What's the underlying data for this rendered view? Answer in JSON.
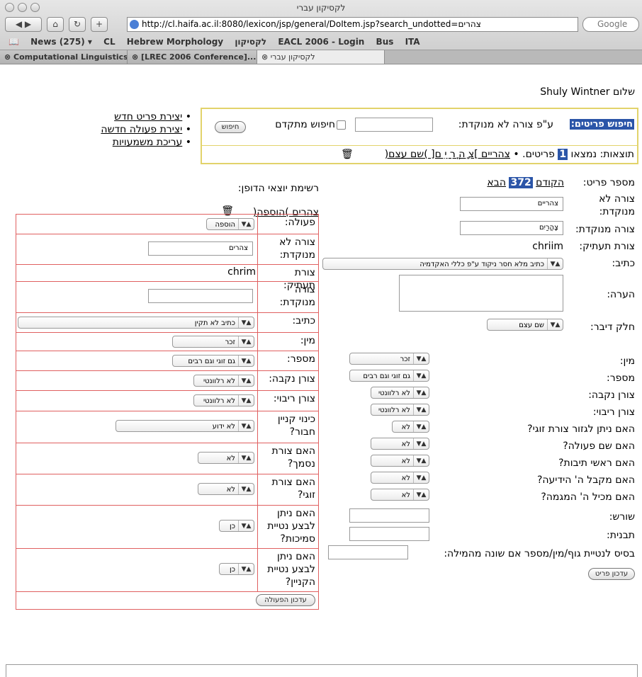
{
  "window": {
    "title": "לקסיקון עברי"
  },
  "toolbar": {
    "url": "http://cl.haifa.ac.il:8080/lexicon/jsp/general/DoItem.jsp?search_undotted=צהרים",
    "search_placeholder": "Google"
  },
  "bookmarks": [
    "News (275) ▾",
    "CL",
    "Hebrew Morphology",
    "לקסיקון",
    "EACL 2006 - Login",
    "Bus",
    "ITA"
  ],
  "tabs": [
    "Computational Linguistics",
    "[LREC 2006 Conference]...",
    "לקסיקון עברי"
  ],
  "greeting": "שלום Shuly Wintner",
  "links": [
    "יצירת פריט חדש",
    "יצירת פעולה חדשה",
    "עריכת משמעויות"
  ],
  "search": {
    "title": "חיפוש פריטים:",
    "by_undotted": "ע\"פ צורה לא מנוקדת:",
    "advanced": "חיפוש מתקדם",
    "button": "חיפוש"
  },
  "results": {
    "prefix": "תוצאות: נמצאו",
    "count": "1",
    "suffix": "פריטים.",
    "item": "צהריים ]צ ָה ֳר ַי ִם[ )שם עצם("
  },
  "item": {
    "number_label": "מספר פריט:",
    "prev": "הקודם",
    "number": "372",
    "next": "הבא",
    "undotted_label": "צורה לא מנוקדת:",
    "undotted_value": "צהריים",
    "dotted_label": "צורה מנוקדת:",
    "dotted_value": "צָהֳרַיִם",
    "translit_label": "צורת תעתיק:",
    "translit_value": "chriim",
    "spelling_label": "כתיב:",
    "spelling_value": "כתיב מלא חסר ניקוד ע\"פ כללי האקדמיה",
    "note_label": "הערה:",
    "pos_label": "חלק דיבר:",
    "pos_value": "שם עצם",
    "gender_label": "מין:",
    "gender_value": "זכר",
    "number2_label": "מספר:",
    "number2_value": "גם זוגי וגם רבים",
    "fem_label": "צורן נקבה:",
    "fem_value": "לא רלוונטי",
    "plural_label": "צורן ריבוי:",
    "plural_value": "לא רלוונטי",
    "dual_q": "האם ניתן לגזור צורת זוגי?",
    "dual_v": "לא",
    "action_q": "האם שם פעולה?",
    "action_v": "לא",
    "acr_q": "האם ראשי תיבות?",
    "acr_v": "לא",
    "def_q": "האם מקבל ה' הידיעה?",
    "def_v": "לא",
    "int_q": "האם מכיל ה' המגמה?",
    "int_v": "לא",
    "root_label": "שורש:",
    "pattern_label": "תבנית:",
    "base_label": "בסיס לנטיית גוף/מין/מספר אם שונה מהמילה:",
    "update": "עדכון פריט"
  },
  "right_panel": {
    "title": "רשימת יוצאי הדופן:",
    "sub": "צהרים )הוספה(",
    "rows": [
      {
        "label": "פעולה:",
        "value": "הוספה"
      },
      {
        "label": "צורה לא מנוקדת:",
        "value": "צהרים"
      },
      {
        "label": "צורת תעתיק:",
        "value": "chrim"
      },
      {
        "label": "צורה מנוקדת:",
        "value": ""
      },
      {
        "label": "כתיב:",
        "value": "כתיב לא תקין"
      },
      {
        "label": "מין:",
        "value": "זכר"
      },
      {
        "label": "מספר:",
        "value": "גם זוגי וגם רבים"
      },
      {
        "label": "צורן נקבה:",
        "value": "לא רלוונטי"
      },
      {
        "label": "צורן ריבוי:",
        "value": "לא רלוונטי"
      },
      {
        "label": "כינוי קניין חבור?",
        "value": "לא ידוע"
      },
      {
        "label": "האם צורת נסמך?",
        "value": "לא"
      },
      {
        "label": "האם צורת זוגי?",
        "value": "לא"
      },
      {
        "label": "האם ניתן לבצע נטיית סמיכות?",
        "value": "כן"
      },
      {
        "label": "האם ניתן לבצע נטיית הקניין?",
        "value": "כן"
      }
    ],
    "update": "עדכון הפעולה"
  }
}
